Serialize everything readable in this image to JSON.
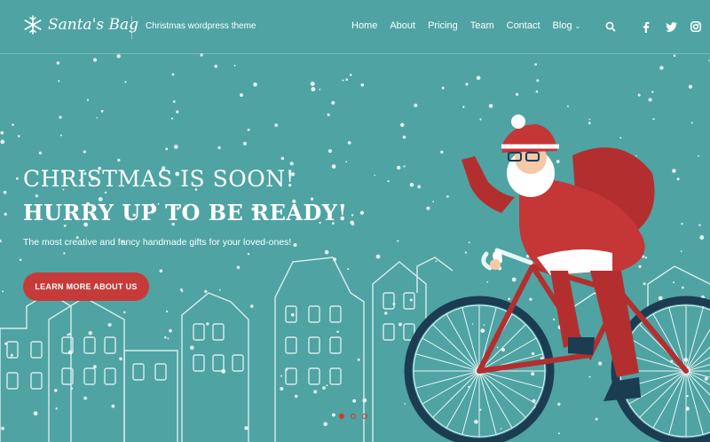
{
  "brand": {
    "name": "Santa's Bag",
    "tagline": "Christmas wordpress theme"
  },
  "nav": {
    "items": [
      {
        "label": "Home"
      },
      {
        "label": "About"
      },
      {
        "label": "Pricing"
      },
      {
        "label": "Team"
      },
      {
        "label": "Contact"
      },
      {
        "label": "Blog"
      }
    ]
  },
  "header_icons": [
    "search-icon",
    "facebook-icon",
    "twitter-icon",
    "instagram-icon"
  ],
  "hero": {
    "headline_1": "CHRISTMAS IS SOON!",
    "headline_2": "HURRY UP TO BE READY!",
    "subtext": "The most creative and fancy handmade gifts for your loved-ones!",
    "cta_label": "LEARN MORE ABOUT US",
    "slider_dots": 3,
    "active_slide": 1
  },
  "colors": {
    "background": "#4fa3a3",
    "accent": "#c73a3a",
    "dot": "#d9342b"
  }
}
